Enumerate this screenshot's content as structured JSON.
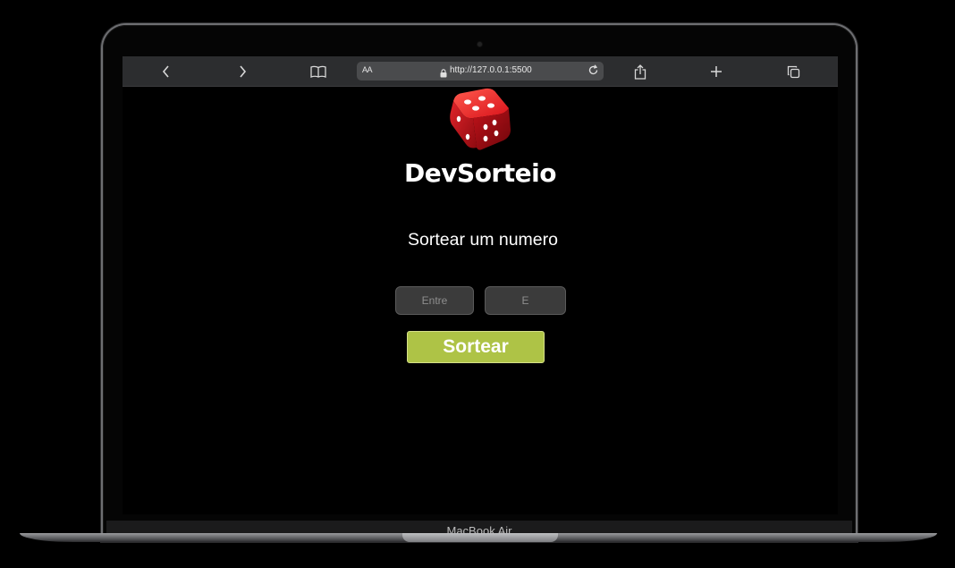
{
  "device": {
    "label": "MacBook Air"
  },
  "browser": {
    "text_size_label": "AA",
    "url": "http://127.0.0.1:5500",
    "icons": {
      "back": "chevron-left-icon",
      "forward": "chevron-right-icon",
      "bookmarks": "book-icon",
      "lock": "lock-icon",
      "reload": "reload-icon",
      "share": "share-icon",
      "new_tab": "plus-icon",
      "tabs": "tabs-icon"
    }
  },
  "page": {
    "logo_icon": "dice-icon",
    "brand": "DevSorteio",
    "subtitle": "Sortear um numero",
    "inputs": {
      "min_placeholder": "Entre",
      "max_placeholder": "E"
    },
    "button_label": "Sortear",
    "colors": {
      "button": "#aec346",
      "dice": "#d8121a"
    }
  }
}
